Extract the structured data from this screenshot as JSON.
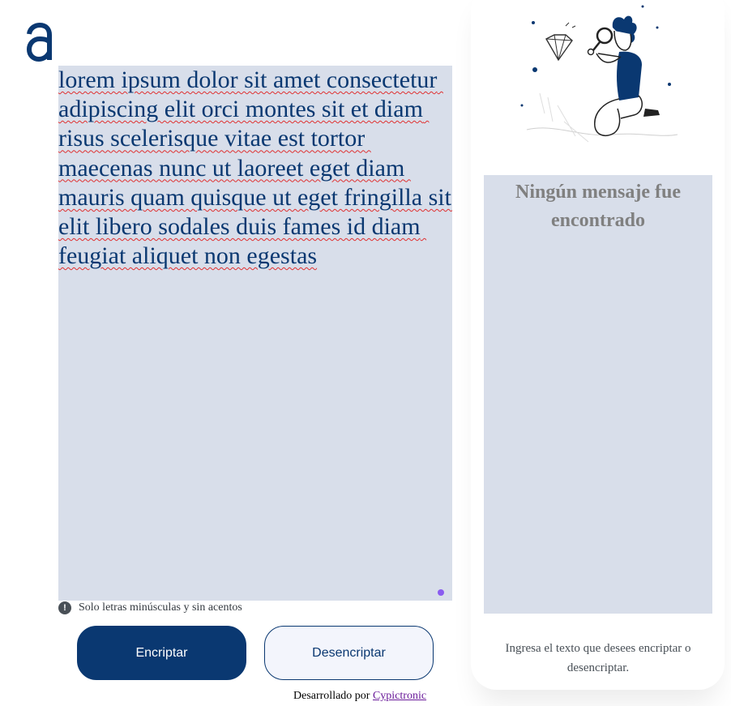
{
  "logo": {
    "alt": "a"
  },
  "editor": {
    "text": "lorem ipsum dolor sit amet consectetur adipiscing elit orci montes sit et diam risus scelerisque vitae est tortor maecenas nunc ut laoreet eget diam mauris quam quisque ut eget fringilla sit elit libero sodales duis fames id diam feugiat aliquet non egestas"
  },
  "hint": {
    "icon": "exclamation-icon",
    "text": "Solo letras minúsculas y sin acentos"
  },
  "buttons": {
    "encrypt": "Encriptar",
    "decrypt": "Desencriptar"
  },
  "footer": {
    "prefix": "Desarrollado por",
    "link": "Cypictronic"
  },
  "output": {
    "title": "Ningún mensaje fue encontrado",
    "description": "Ingresa el texto que desees encriptar o desencriptar."
  },
  "colors": {
    "primary": "#0a3871",
    "surface": "#d8deea",
    "muted": "#808080"
  }
}
